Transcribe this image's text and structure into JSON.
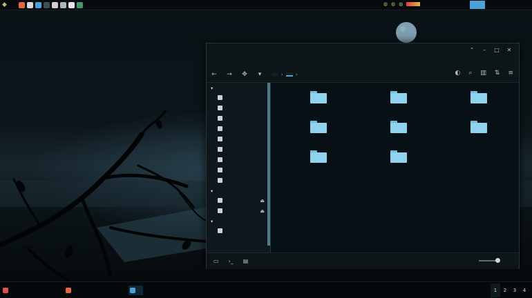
{
  "top_panel": {
    "app_name": "",
    "center_items": [
      "",
      ""
    ],
    "clock": "",
    "user": ""
  },
  "window": {
    "title": "",
    "controls": [
      "⌃",
      "–",
      "□",
      "✕"
    ],
    "menu": [
      "",
      "",
      "",
      "",
      "",
      ""
    ],
    "breadcrumb": [
      "",
      ""
    ],
    "sidebar": {
      "sections": [
        {
          "title": "",
          "items": [
            "",
            "",
            "",
            "",
            "",
            "",
            "",
            "",
            ""
          ]
        },
        {
          "title": "",
          "items": [
            "",
            ""
          ]
        },
        {
          "title": "",
          "items": [
            ""
          ]
        }
      ]
    },
    "files": [
      "",
      "",
      "",
      "",
      "",
      "",
      "",
      ""
    ],
    "status_text": ""
  },
  "taskbar": {
    "tasks": [
      "",
      "",
      ""
    ],
    "pager": [
      "1",
      "2",
      "3",
      "4"
    ]
  },
  "colors": {
    "accent": "#3fa7d6",
    "folder": "#8fd3ef",
    "panel_bg": "#070b0d",
    "window_bg": "#0b1215"
  },
  "icons": {
    "launcher": [
      "firefox-icon",
      "mail-icon",
      "files-icon",
      "terminal-icon",
      "settings-icon",
      "tools-icon",
      "image-icon",
      "reload-icon"
    ]
  }
}
